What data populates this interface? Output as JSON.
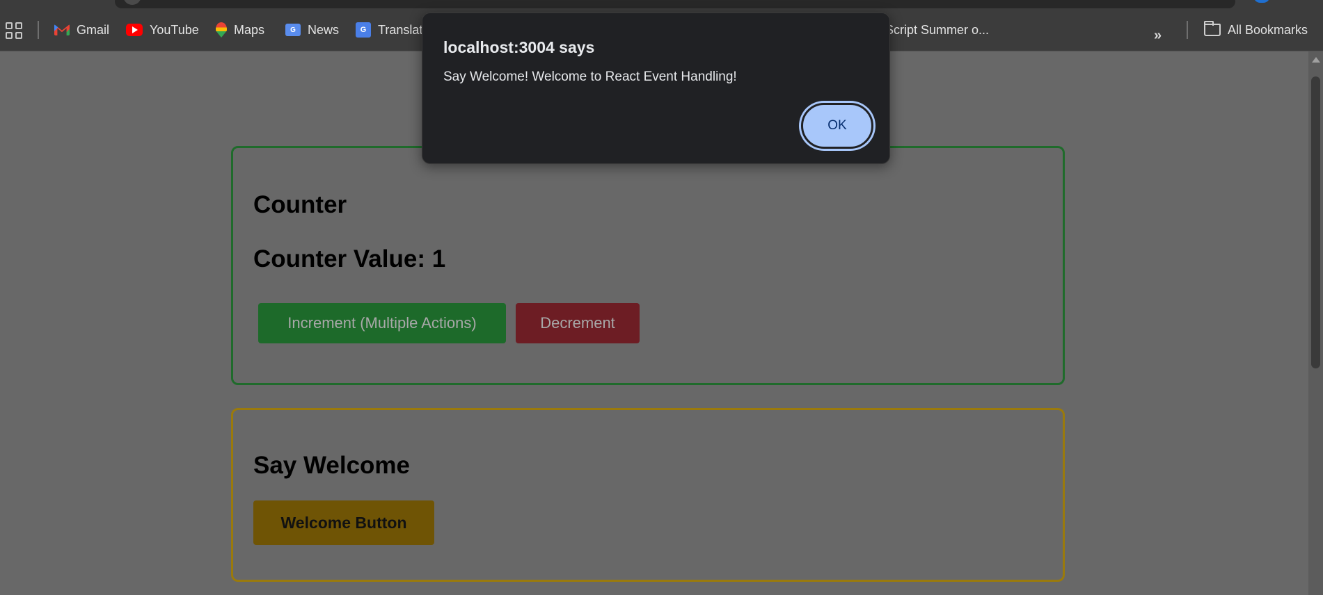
{
  "bookmarks": {
    "items": [
      {
        "label": "Gmail",
        "icon": "gmail-icon"
      },
      {
        "label": "YouTube",
        "icon": "youtube-icon"
      },
      {
        "label": "Maps",
        "icon": "maps-icon"
      },
      {
        "label": "News",
        "icon": "news-icon"
      },
      {
        "label": "Translat",
        "icon": "translate-icon"
      },
      {
        "label": "rlScript Summer o...",
        "icon": ""
      }
    ],
    "overflow_glyph": "»",
    "all_bookmarks_label": "All Bookmarks"
  },
  "dialog": {
    "title": "localhost:3004 says",
    "message": "Say Welcome! Welcome to React Event Handling!",
    "ok_label": "OK"
  },
  "counter_card": {
    "heading": "Counter",
    "value_text": "Counter Value: 1",
    "increment_label": "Increment (Multiple Actions)",
    "decrement_label": "Decrement"
  },
  "welcome_card": {
    "heading": "Say Welcome",
    "button_label": "Welcome Button"
  },
  "colors": {
    "counter_border": "#1f6b2b",
    "welcome_border": "#9a7a0c",
    "increment_bg": "#1d6a2a",
    "decrement_bg": "#6d1d24",
    "welcome_bg": "#6f5405",
    "dialog_bg": "#202124",
    "ok_bg": "#a8c7fa"
  }
}
